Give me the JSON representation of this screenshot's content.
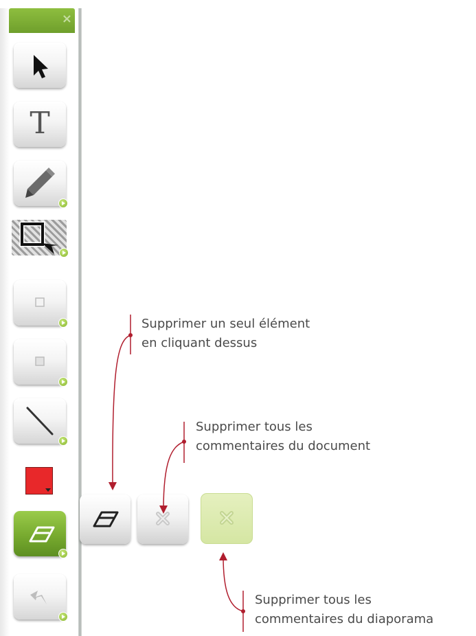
{
  "toolbar": {
    "close_icon": "×",
    "tools": [
      {
        "name": "select-tool",
        "icon": "cursor-arrow-icon"
      },
      {
        "name": "text-tool",
        "icon": "text-t-icon",
        "glyph": "T"
      },
      {
        "name": "pen-tool",
        "icon": "pencil-icon"
      },
      {
        "name": "frame-select-tool",
        "icon": "marquee-select-icon"
      },
      {
        "name": "rectangle-tool",
        "icon": "rectangle-icon"
      },
      {
        "name": "filled-rectangle-tool",
        "icon": "filled-rectangle-icon"
      },
      {
        "name": "line-tool",
        "icon": "line-icon"
      },
      {
        "name": "color-picker",
        "icon": "color-swatch",
        "color": "#e8282a"
      },
      {
        "name": "eraser-tool",
        "icon": "eraser-icon",
        "active": true
      },
      {
        "name": "undo-tool",
        "icon": "undo-arrow-icon"
      }
    ]
  },
  "eraser_submenu": [
    {
      "name": "erase-single-button",
      "icon": "eraser-icon"
    },
    {
      "name": "erase-document-button",
      "icon": "clear-cross-icon"
    },
    {
      "name": "erase-slideshow-button",
      "icon": "clear-cross-icon",
      "color": "#d5e6a3"
    }
  ],
  "callouts": {
    "single": {
      "line1": "Supprimer un seul élément",
      "line2": "en cliquant dessus"
    },
    "document": {
      "line1": "Supprimer tous les",
      "line2": "commentaires du document"
    },
    "slideshow": {
      "line1": "Supprimer tous les",
      "line2": "commentaires du diaporama"
    }
  },
  "colors": {
    "accent_green": "#77aa2f",
    "callout_line": "#b01e2e",
    "text": "#4a4a4a"
  }
}
